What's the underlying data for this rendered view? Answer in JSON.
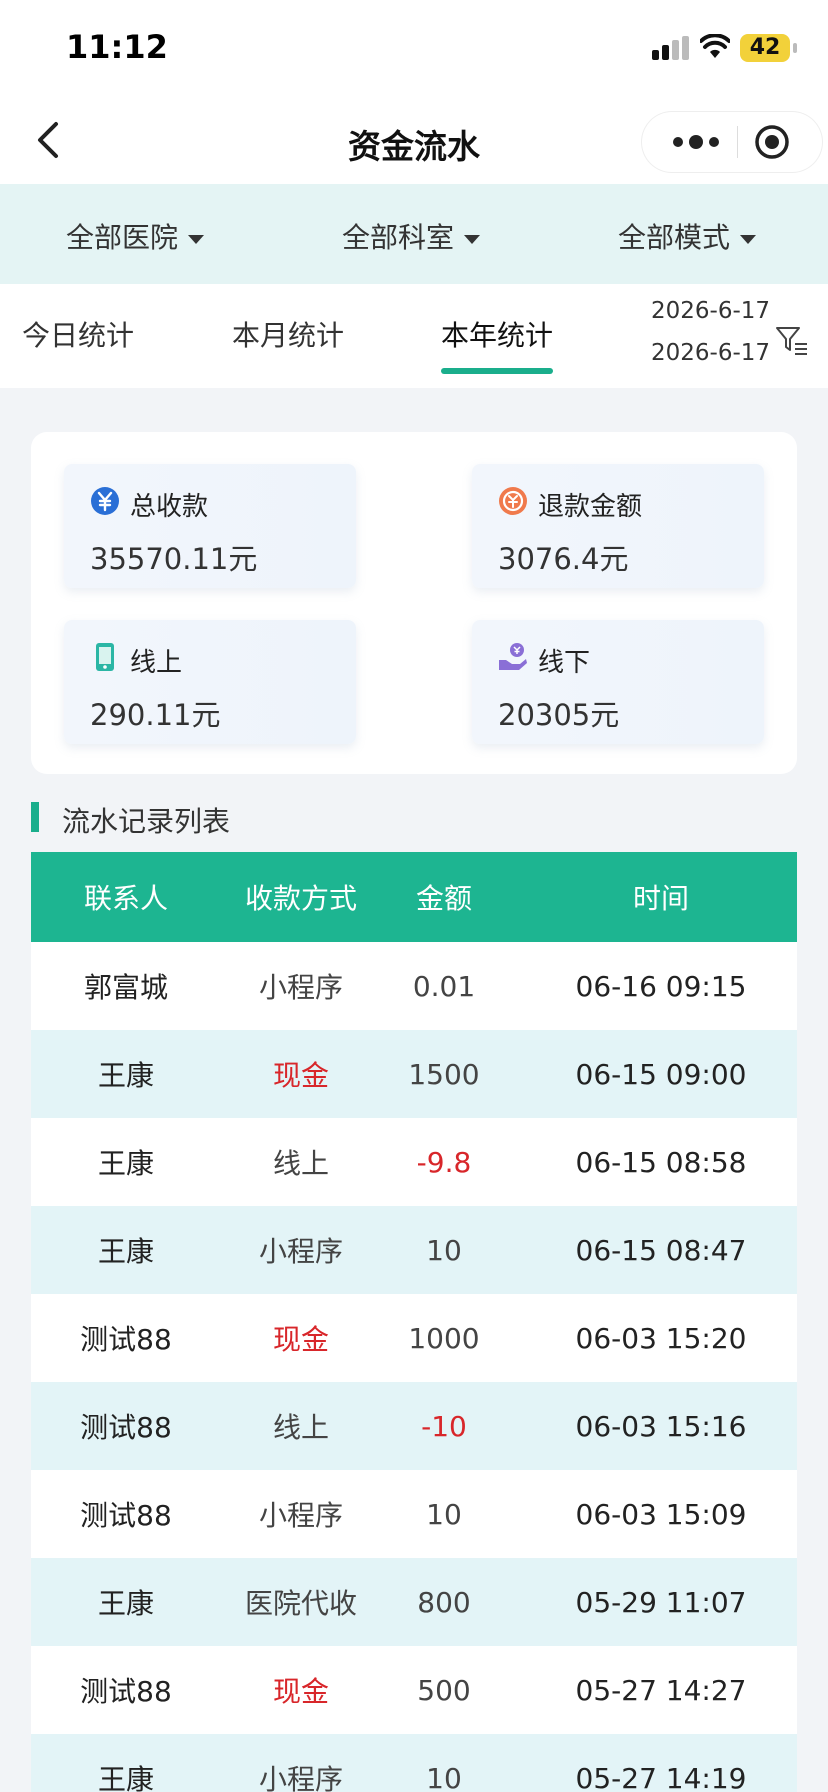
{
  "status": {
    "time": "11:12",
    "battery": "42"
  },
  "nav": {
    "title": "资金流水"
  },
  "filters": [
    "全部医院",
    "全部科室",
    "全部模式"
  ],
  "tabs": [
    "今日统计",
    "本月统计",
    "本年统计"
  ],
  "active_tab": "本年统计",
  "date_range": {
    "start": "2026-6-17",
    "end": "2026-6-17"
  },
  "stats": {
    "total": {
      "label": "总收款",
      "value": "35570.11元"
    },
    "refund": {
      "label": "退款金额",
      "value": "3076.4元"
    },
    "online": {
      "label": "线上",
      "value": "290.11元"
    },
    "offline": {
      "label": "线下",
      "value": "20305元"
    }
  },
  "section": {
    "title": "流水记录列表"
  },
  "table": {
    "headers": [
      "联系人",
      "收款方式",
      "金额",
      "时间"
    ],
    "rows": [
      {
        "contact": "郭富城",
        "method": "小程序",
        "amount": "0.01",
        "time": "06-16 09:15"
      },
      {
        "contact": "王康",
        "method": "现金",
        "amount": "1500",
        "time": "06-15 09:00"
      },
      {
        "contact": "王康",
        "method": "线上",
        "amount": "-9.8",
        "time": "06-15 08:58"
      },
      {
        "contact": "王康",
        "method": "小程序",
        "amount": "10",
        "time": "06-15 08:47"
      },
      {
        "contact": "测试88",
        "method": "现金",
        "amount": "1000",
        "time": "06-03 15:20"
      },
      {
        "contact": "测试88",
        "method": "线上",
        "amount": "-10",
        "time": "06-03 15:16"
      },
      {
        "contact": "测试88",
        "method": "小程序",
        "amount": "10",
        "time": "06-03 15:09"
      },
      {
        "contact": "王康",
        "method": "医院代收",
        "amount": "800",
        "time": "05-29 11:07"
      },
      {
        "contact": "测试88",
        "method": "现金",
        "amount": "500",
        "time": "05-27 14:27"
      },
      {
        "contact": "王康",
        "method": "小程序",
        "amount": "10",
        "time": "05-27 14:19"
      }
    ]
  },
  "colors": {
    "accent": "#1db591",
    "negative": "#d8262a",
    "row_alt": "#e3f4f7",
    "filter_bg": "#e4f4f4"
  }
}
